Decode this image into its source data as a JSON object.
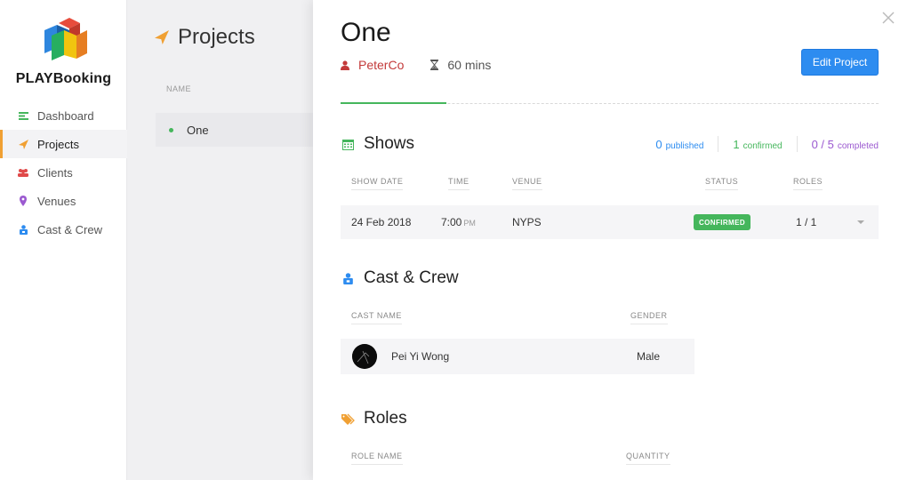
{
  "sidebar": {
    "brand": "PLAYBooking",
    "items": [
      {
        "label": "Dashboard",
        "icon": "dashboard-icon",
        "color": "#45b65c"
      },
      {
        "label": "Projects",
        "icon": "paper-plane-icon",
        "color": "#f0a033"
      },
      {
        "label": "Clients",
        "icon": "users-icon",
        "color": "#e04a4a"
      },
      {
        "label": "Venues",
        "icon": "map-marker-icon",
        "color": "#9b59d0"
      },
      {
        "label": "Cast & Crew",
        "icon": "user-badge-icon",
        "color": "#2d8cf0"
      }
    ],
    "active": "Projects"
  },
  "projects": {
    "title": "Projects",
    "column_header": "NAME",
    "items": [
      {
        "name": "One",
        "status_color": "#45b65c"
      }
    ]
  },
  "detail": {
    "title": "One",
    "owner": "PeterCo",
    "duration": "60 mins",
    "edit_label": "Edit Project",
    "shows": {
      "title": "Shows",
      "stats": {
        "published_num": "0",
        "published_label": "published",
        "confirmed_num": "1",
        "confirmed_label": "confirmed",
        "completed_num": "0 / 5",
        "completed_label": "completed"
      },
      "headers": {
        "date": "SHOW DATE",
        "time": "TIME",
        "venue": "VENUE",
        "status": "STATUS",
        "roles": "ROLES"
      },
      "rows": [
        {
          "date": "24 Feb 2018",
          "time": "7:00",
          "ampm": "PM",
          "venue": "NYPS",
          "status": "CONFIRMED",
          "roles": "1 / 1"
        }
      ]
    },
    "cast": {
      "title": "Cast & Crew",
      "headers": {
        "name": "CAST NAME",
        "gender": "GENDER"
      },
      "rows": [
        {
          "name": "Pei Yi Wong",
          "gender": "Male"
        }
      ]
    },
    "roles": {
      "title": "Roles",
      "headers": {
        "name": "ROLE NAME",
        "quantity": "QUANTITY"
      }
    }
  },
  "colors": {
    "accent_blue": "#2d8cf0",
    "green": "#45b65c",
    "orange": "#f0a033",
    "red": "#c33a3a",
    "purple": "#9b59d0"
  }
}
